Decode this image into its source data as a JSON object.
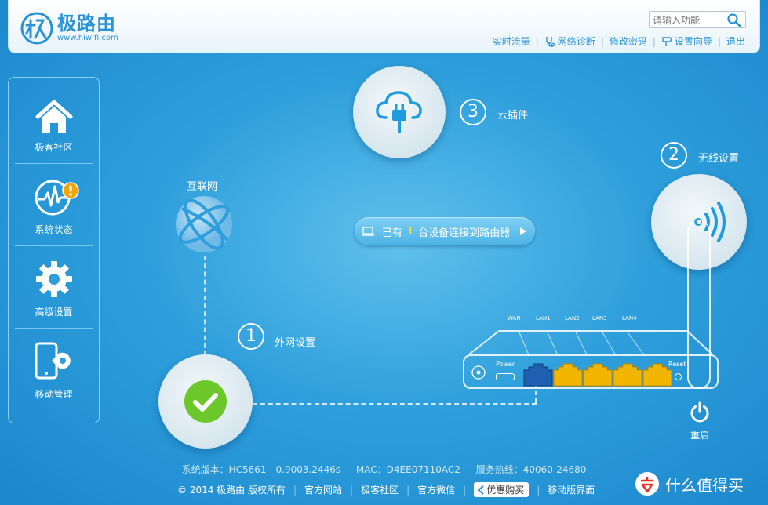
{
  "brand": {
    "name": "极路由",
    "url": "www.hiwifi.com"
  },
  "search": {
    "placeholder": "请输入功能"
  },
  "top_links": [
    "实时流量",
    "网络诊断",
    "修改密码",
    "设置向导",
    "退出"
  ],
  "sidebar": {
    "items": [
      {
        "label": "极客社区",
        "icon": "home-icon"
      },
      {
        "label": "系统状态",
        "icon": "pulse-icon",
        "badge": "!"
      },
      {
        "label": "高级设置",
        "icon": "gear-icon"
      },
      {
        "label": "移动管理",
        "icon": "mobile-icon"
      }
    ]
  },
  "diagram": {
    "internet_label": "互联网",
    "step1": {
      "number": "1",
      "label": "外网设置"
    },
    "step2": {
      "number": "2",
      "label": "无线设置"
    },
    "step3": {
      "number": "3",
      "label": "云插件"
    },
    "status": {
      "prefix": "已有",
      "count": "1",
      "suffix": "台设备连接到路由器"
    },
    "router": {
      "power_label": "Power",
      "reset_label": "Reset",
      "ports": [
        "WAN",
        "LAN1",
        "LAN2",
        "LAN3",
        "LAN4"
      ]
    },
    "reboot_label": "重启"
  },
  "footer": {
    "version": "系统版本：HC5661 - 0.9003.2446s",
    "mac": "MAC：D4EE07110AC2",
    "hotline": "服务热线：40060-24680",
    "copyright": "© 2014 极路由 版权所有",
    "links": [
      "官方网站",
      "极客社区",
      "官方微信"
    ],
    "coupon": "优惠购买",
    "mobile": "移动版界面"
  },
  "watermark": "什么值得买",
  "colors": {
    "accent": "#2a93d5",
    "background": "#2e9fdc",
    "check": "#6cc72b",
    "port_wan": "#1f5fb0",
    "port_lan": "#f3b600",
    "badge": "#f5a300"
  }
}
